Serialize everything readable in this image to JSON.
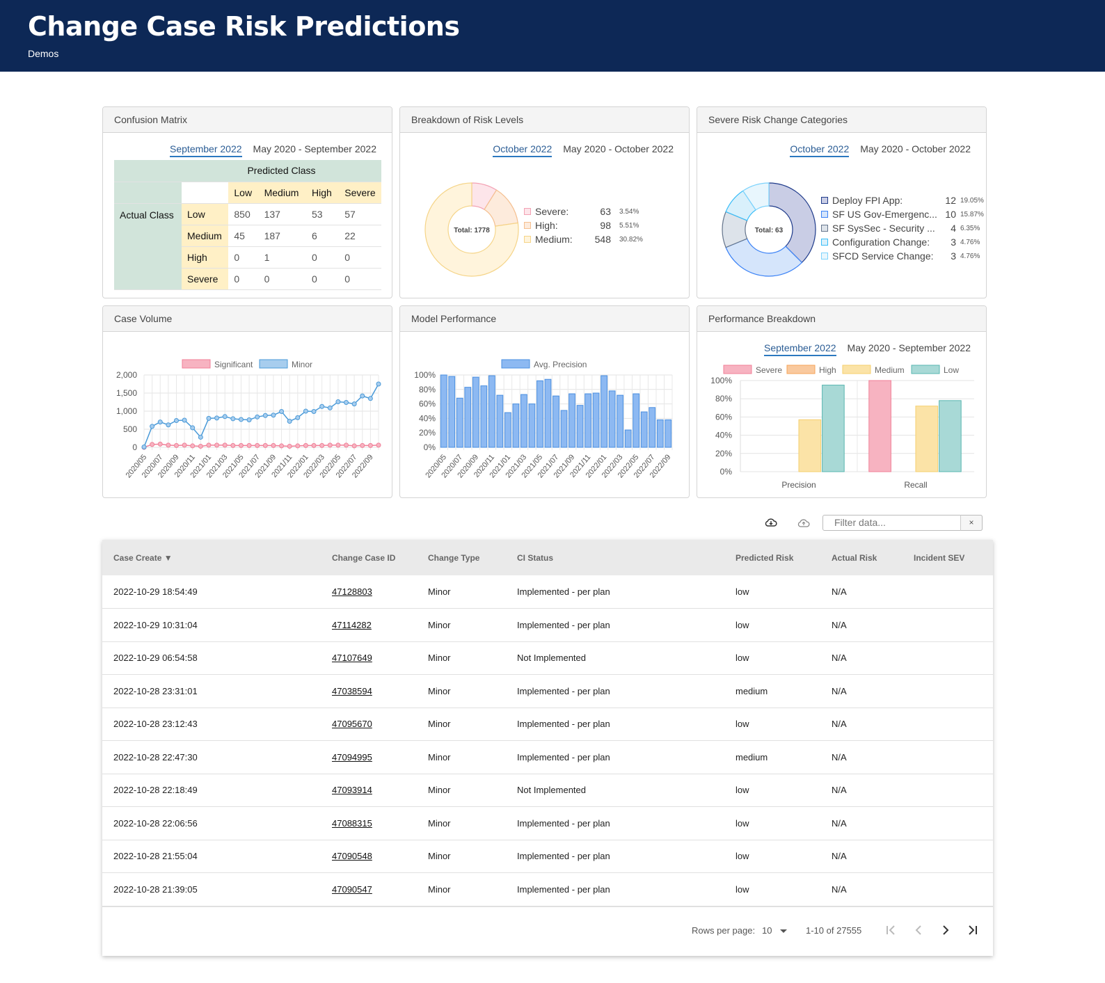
{
  "header": {
    "title": "Change Case Risk Predictions",
    "subtitle": "Demos"
  },
  "confusion": {
    "title": "Confusion Matrix",
    "tabs": [
      "September 2022",
      "May 2020 - September 2022"
    ],
    "predicted_label": "Predicted Class",
    "actual_label": "Actual Class",
    "cols": [
      "Low",
      "Medium",
      "High",
      "Severe"
    ],
    "rows": [
      {
        "label": "Low",
        "values": [
          "850",
          "137",
          "53",
          "57"
        ]
      },
      {
        "label": "Medium",
        "values": [
          "45",
          "187",
          "6",
          "22"
        ]
      },
      {
        "label": "High",
        "values": [
          "0",
          "1",
          "0",
          "0"
        ]
      },
      {
        "label": "Severe",
        "values": [
          "0",
          "0",
          "0",
          "0"
        ]
      }
    ]
  },
  "risk_levels": {
    "title": "Breakdown of Risk Levels",
    "tabs": [
      "October 2022",
      "May 2020 - October 2022"
    ],
    "total_label": "Total: 1778",
    "items": [
      {
        "label": "Severe:",
        "count": "63",
        "pct": "3.54%",
        "color": "#f3a1b3",
        "fill": "#fde5ea"
      },
      {
        "label": "High:",
        "count": "98",
        "pct": "5.51%",
        "color": "#f5bf8f",
        "fill": "#fdebdc"
      },
      {
        "label": "Medium:",
        "count": "548",
        "pct": "30.82%",
        "color": "#f5d487",
        "fill": "#fff4dc"
      }
    ]
  },
  "severe_categories": {
    "title": "Severe Risk Change Categories",
    "tabs": [
      "October 2022",
      "May 2020 - October 2022"
    ],
    "total_label": "Total: 63",
    "items": [
      {
        "label": "Deploy FPI App:",
        "count": "12",
        "pct": "19.05%",
        "color": "#1e3a8a",
        "fill": "#c9cde5"
      },
      {
        "label": "SF US Gov-Emergenc...",
        "count": "10",
        "pct": "15.87%",
        "color": "#3b82f6",
        "fill": "#d5e5fb"
      },
      {
        "label": "SF SysSec - Security ...",
        "count": "4",
        "pct": "6.35%",
        "color": "#64748b",
        "fill": "#dde3ea"
      },
      {
        "label": "Configuration Change:",
        "count": "3",
        "pct": "4.76%",
        "color": "#38bdf8",
        "fill": "#d9f0fb"
      },
      {
        "label": "SFCD Service Change:",
        "count": "3",
        "pct": "4.76%",
        "color": "#7dd3fc",
        "fill": "#e8f6fd"
      }
    ]
  },
  "case_volume": {
    "title": "Case Volume"
  },
  "model_perf": {
    "title": "Model Performance"
  },
  "perf_breakdown": {
    "title": "Performance Breakdown",
    "tabs": [
      "September 2022",
      "May 2020 - September 2022"
    ]
  },
  "chart_data": [
    {
      "type": "line",
      "title": "Case Volume",
      "x": [
        "2020/05",
        "2020/06",
        "2020/07",
        "2020/08",
        "2020/09",
        "2020/10",
        "2020/11",
        "2020/12",
        "2021/01",
        "2021/02",
        "2021/03",
        "2021/04",
        "2021/05",
        "2021/06",
        "2021/07",
        "2021/08",
        "2021/09",
        "2021/10",
        "2021/11",
        "2021/12",
        "2022/01",
        "2022/02",
        "2022/03",
        "2022/04",
        "2022/05",
        "2022/06",
        "2022/07",
        "2022/08",
        "2022/09",
        "2022/10"
      ],
      "x_tick_labels": [
        "2020/05",
        "2020/07",
        "2020/09",
        "2020/11",
        "2021/01",
        "2021/03",
        "2021/05",
        "2021/07",
        "2021/09",
        "2021/11",
        "2022/01",
        "2022/03",
        "2022/05",
        "2022/07",
        "2022/09"
      ],
      "ylim": [
        0,
        2000
      ],
      "y_ticks": [
        "0",
        "500",
        "1,000",
        "1,500",
        "2,000"
      ],
      "series": [
        {
          "name": "Significant",
          "color": "#f07f97",
          "fill": "#f7b3c1",
          "values": [
            0,
            80,
            90,
            60,
            50,
            60,
            40,
            30,
            60,
            60,
            60,
            50,
            50,
            50,
            50,
            50,
            50,
            40,
            30,
            40,
            50,
            50,
            50,
            60,
            60,
            60,
            40,
            50,
            50,
            60
          ]
        },
        {
          "name": "Minor",
          "color": "#4a9ad8",
          "fill": "#a7cdee",
          "values": [
            10,
            580,
            700,
            620,
            740,
            750,
            540,
            280,
            800,
            810,
            850,
            790,
            770,
            760,
            840,
            880,
            890,
            990,
            720,
            820,
            1000,
            990,
            1130,
            1090,
            1260,
            1240,
            1200,
            1420,
            1350,
            1750
          ]
        }
      ],
      "grid": true,
      "legend": "top"
    },
    {
      "type": "bar",
      "title": "Model Performance",
      "x": [
        "2020/05",
        "2020/06",
        "2020/07",
        "2020/08",
        "2020/09",
        "2020/10",
        "2020/11",
        "2020/12",
        "2021/01",
        "2021/02",
        "2021/03",
        "2021/04",
        "2021/05",
        "2021/06",
        "2021/07",
        "2021/08",
        "2021/09",
        "2021/10",
        "2021/11",
        "2021/12",
        "2022/01",
        "2022/02",
        "2022/03",
        "2022/04",
        "2022/05",
        "2022/06",
        "2022/07",
        "2022/08",
        "2022/09"
      ],
      "x_tick_labels": [
        "2020/05",
        "2020/07",
        "2020/09",
        "2020/11",
        "2021/01",
        "2021/03",
        "2021/05",
        "2021/07",
        "2021/09",
        "2021/11",
        "2022/01",
        "2022/03",
        "2022/05",
        "2022/07",
        "2022/09"
      ],
      "ylim": [
        0,
        100
      ],
      "y_ticks": [
        "0%",
        "20%",
        "40%",
        "60%",
        "80%",
        "100%"
      ],
      "series": [
        {
          "name": "Avg. Precision",
          "color": "#4a8fe0",
          "fill": "#8db9f2",
          "values": [
            100,
            98,
            68,
            83,
            97,
            85,
            99,
            72,
            48,
            60,
            73,
            60,
            92,
            94,
            71,
            51,
            74,
            58,
            74,
            75,
            99,
            78,
            72,
            24,
            74,
            49,
            55,
            38,
            38
          ]
        }
      ],
      "grid": true,
      "legend": "top"
    },
    {
      "type": "bar",
      "title": "Performance Breakdown",
      "categories": [
        "Precision",
        "Recall"
      ],
      "ylim": [
        0,
        100
      ],
      "y_ticks": [
        "0%",
        "20%",
        "40%",
        "60%",
        "80%",
        "100%"
      ],
      "series": [
        {
          "name": "Severe",
          "color": "#f07f97",
          "fill": "#f7b3c1",
          "values": [
            0,
            100
          ]
        },
        {
          "name": "High",
          "color": "#f5a45a",
          "fill": "#f9c99e",
          "values": [
            0,
            0
          ]
        },
        {
          "name": "Medium",
          "color": "#f5cf6e",
          "fill": "#fbe3a7",
          "values": [
            57,
            72
          ]
        },
        {
          "name": "Low",
          "color": "#58b6b0",
          "fill": "#a8d9d6",
          "values": [
            95,
            78
          ]
        }
      ],
      "grid": true,
      "legend": "top"
    }
  ],
  "toolbar": {
    "filter_placeholder": "Filter data...",
    "clear_label": "×"
  },
  "table": {
    "columns": [
      "Case Create ▼",
      "Change Case ID",
      "Change Type",
      "CI Status",
      "Predicted Risk",
      "Actual Risk",
      "Incident SEV"
    ],
    "rows": [
      [
        "2022-10-29 18:54:49",
        "47128803",
        "Minor",
        "Implemented - per plan",
        "low",
        "N/A",
        ""
      ],
      [
        "2022-10-29 10:31:04",
        "47114282",
        "Minor",
        "Implemented - per plan",
        "low",
        "N/A",
        ""
      ],
      [
        "2022-10-29 06:54:58",
        "47107649",
        "Minor",
        "Not Implemented",
        "low",
        "N/A",
        ""
      ],
      [
        "2022-10-28 23:31:01",
        "47038594",
        "Minor",
        "Implemented - per plan",
        "medium",
        "N/A",
        ""
      ],
      [
        "2022-10-28 23:12:43",
        "47095670",
        "Minor",
        "Implemented - per plan",
        "low",
        "N/A",
        ""
      ],
      [
        "2022-10-28 22:47:30",
        "47094995",
        "Minor",
        "Implemented - per plan",
        "medium",
        "N/A",
        ""
      ],
      [
        "2022-10-28 22:18:49",
        "47093914",
        "Minor",
        "Not Implemented",
        "low",
        "N/A",
        ""
      ],
      [
        "2022-10-28 22:06:56",
        "47088315",
        "Minor",
        "Implemented - per plan",
        "low",
        "N/A",
        ""
      ],
      [
        "2022-10-28 21:55:04",
        "47090548",
        "Minor",
        "Implemented - per plan",
        "low",
        "N/A",
        ""
      ],
      [
        "2022-10-28 21:39:05",
        "47090547",
        "Minor",
        "Implemented - per plan",
        "low",
        "N/A",
        ""
      ]
    ]
  },
  "pager": {
    "rows_label": "Rows per page:",
    "rows_value": "10",
    "range": "1-10 of 27555"
  }
}
